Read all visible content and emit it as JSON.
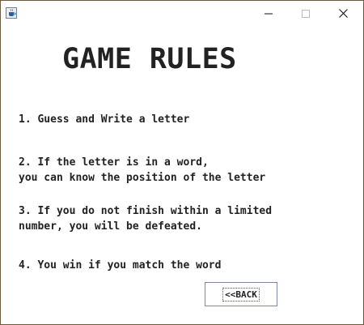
{
  "window": {
    "icon": "java-cup-icon",
    "controls": {
      "minimize_icon": "minimize-icon",
      "maximize_icon": "maximize-icon",
      "close_icon": "close-icon"
    }
  },
  "title": "GAME RULES",
  "rules": [
    {
      "line1": "1. Guess and Write a letter"
    },
    {
      "line1": "2. If the letter is in a word,",
      "line2": "you can know the position of the letter"
    },
    {
      "line1": "3. If you do not finish within a limited",
      "line2": "number, you will be defeated."
    },
    {
      "line1": "4. You win if you match the word"
    }
  ],
  "back_button": {
    "label": "<<BACK"
  },
  "colors": {
    "background": "#ffffff",
    "text": "#222222",
    "window_border": "#6b5a3e",
    "button_border": "#7a8aa6"
  }
}
